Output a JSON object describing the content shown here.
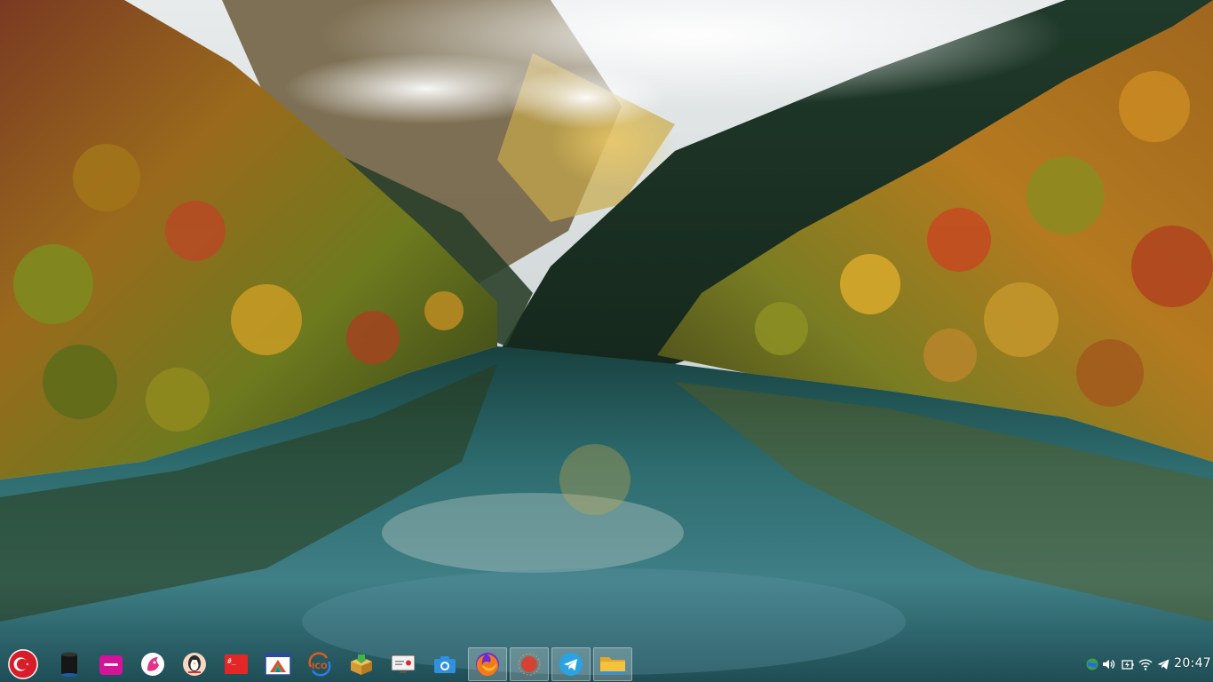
{
  "desktop": {
    "wallpaper": "autumn-lake-valley"
  },
  "taskbar": {
    "launcher": {
      "icon": "turkish-flag-menu-icon"
    },
    "items": [
      {
        "name": "terminal-app",
        "icon": "black-cylinder-icon",
        "active": false
      },
      {
        "name": "media-app",
        "icon": "magenta-folder-icon",
        "active": false
      },
      {
        "name": "pardus-app",
        "icon": "pink-fox-icon",
        "active": false
      },
      {
        "name": "pet-app",
        "icon": "penguin-icon",
        "active": false
      },
      {
        "name": "terminal-red-app",
        "icon": "red-terminal-icon",
        "active": false
      },
      {
        "name": "image-viewer-app",
        "icon": "triangle-window-icon",
        "active": false
      },
      {
        "name": "icon-converter-app",
        "icon": "ico-converter-icon",
        "active": false
      },
      {
        "name": "package-installer-app",
        "icon": "package-box-icon",
        "active": false
      },
      {
        "name": "screen-recorder-app",
        "icon": "screen-recorder-icon",
        "active": false
      },
      {
        "name": "screenshot-app",
        "icon": "camera-icon",
        "active": false
      },
      {
        "name": "firefox-app",
        "icon": "firefox-icon",
        "active": true
      },
      {
        "name": "app-window",
        "icon": "red-circle-icon",
        "active": true
      },
      {
        "name": "telegram-app",
        "icon": "telegram-icon",
        "active": true
      },
      {
        "name": "file-manager-app",
        "icon": "yellow-folder-icon",
        "active": true
      }
    ],
    "colors": {
      "magenta": "#d4139a",
      "firefox_orange": "#f27a1a",
      "telegram_blue": "#2aa3e0",
      "folder_yellow": "#f5c33b",
      "flag_red": "#d91c2a"
    }
  },
  "tray": {
    "icons": [
      "network-globe-icon",
      "volume-icon",
      "battery-icon",
      "wifi-icon",
      "telegram-tray-icon"
    ],
    "clock": "20:47"
  }
}
